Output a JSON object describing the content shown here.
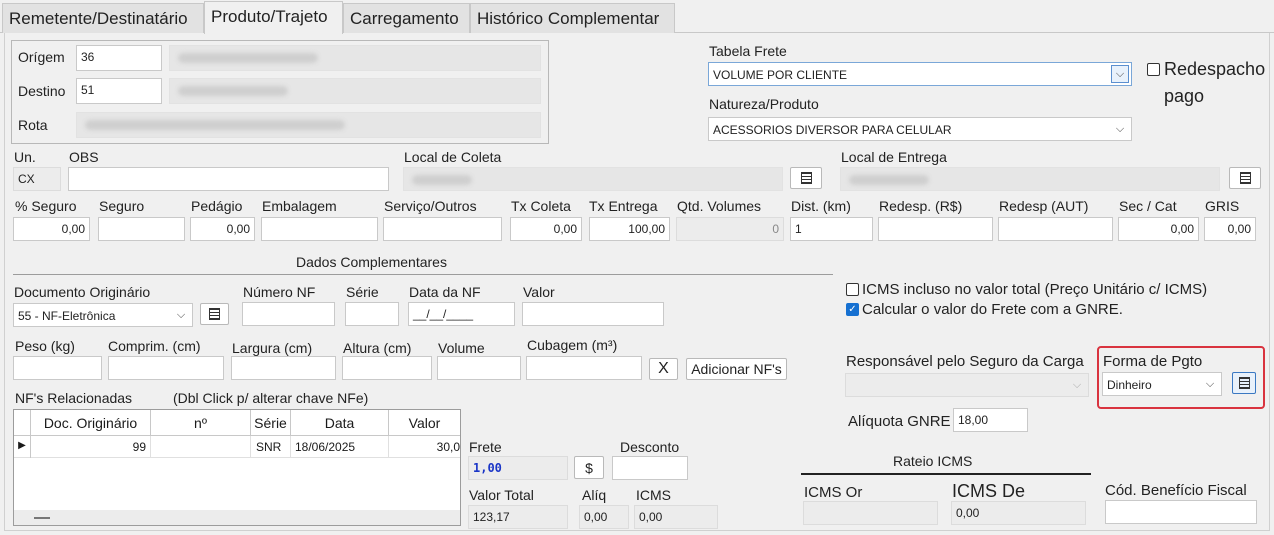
{
  "tabs": [
    "Remetente/Destinatário",
    "Produto/Trajeto",
    "Carregamento",
    "Histórico Complementar"
  ],
  "route": {
    "origem_label": "Orígem",
    "origem_value": "36",
    "destino_label": "Destino",
    "destino_value": "51",
    "rota_label": "Rota"
  },
  "tabela_frete": {
    "label": "Tabela Frete",
    "value": "VOLUME POR CLIENTE"
  },
  "natureza": {
    "label": "Natureza/Produto",
    "value": "ACESSORIOS DIVERSOR PARA CELULAR"
  },
  "redespacho": {
    "label_line1": "Redespacho",
    "label_line2": "pago"
  },
  "un": {
    "label": "Un.",
    "value": "CX"
  },
  "obs": {
    "label": "OBS",
    "value": ""
  },
  "local_coleta": {
    "label": "Local de Coleta"
  },
  "local_entrega": {
    "label": "Local de Entrega"
  },
  "values_row": {
    "pct_seguro": {
      "label": "% Seguro",
      "value": "0,00"
    },
    "seguro": {
      "label": "Seguro",
      "value": ""
    },
    "pedagio": {
      "label": "Pedágio",
      "value": "0,00"
    },
    "embalagem": {
      "label": "Embalagem",
      "value": ""
    },
    "servico": {
      "label": "Serviço/Outros",
      "value": ""
    },
    "tx_coleta": {
      "label": "Tx Coleta",
      "value": "0,00"
    },
    "tx_entrega": {
      "label": "Tx Entrega",
      "value": "100,00"
    },
    "qtd_volumes": {
      "label": "Qtd. Volumes",
      "value": "0"
    },
    "dist": {
      "label": "Dist. (km)",
      "value": "1"
    },
    "redesp_rs": {
      "label": "Redesp. (R$)",
      "value": ""
    },
    "redesp_aut": {
      "label": "Redesp (AUT)",
      "value": ""
    },
    "sec_cat": {
      "label": "Sec / Cat",
      "value": "0,00"
    },
    "gris": {
      "label": "GRIS",
      "value": "0,00"
    }
  },
  "dados_complementares": {
    "title": "Dados Complementares",
    "doc_originario": {
      "label": "Documento Originário",
      "value": "55 - NF-Eletrônica"
    },
    "numero_nf": {
      "label": "Número NF",
      "value": ""
    },
    "serie": {
      "label": "Série",
      "value": ""
    },
    "data_nf": {
      "label": "Data da NF",
      "value": "__/__/____"
    },
    "valor": {
      "label": "Valor",
      "value": ""
    },
    "peso": {
      "label": "Peso (kg)"
    },
    "comprim": {
      "label": "Comprim. (cm)"
    },
    "largura": {
      "label": "Largura (cm)"
    },
    "altura": {
      "label": "Altura (cm)"
    },
    "volume": {
      "label": "Volume"
    },
    "cubagem": {
      "label": "Cubagem (m³)"
    },
    "clear_label": "X",
    "adicionar_label": "Adicionar NF's"
  },
  "nfs": {
    "label": "NF's Relacionadas",
    "hint": "(Dbl Click p/ alterar chave NFe)",
    "columns": [
      "Doc. Originário",
      "nº",
      "Série",
      "Data",
      "Valor"
    ],
    "rows": [
      {
        "doc": "99",
        "n": "",
        "serie": "SNR",
        "data": "18/06/2025",
        "valor": "30,0"
      }
    ]
  },
  "frete": {
    "label": "Frete",
    "value": "1,00",
    "currency_btn": "$"
  },
  "desconto": {
    "label": "Desconto",
    "value": ""
  },
  "valor_total": {
    "label": "Valor Total",
    "value": "123,17"
  },
  "aliq": {
    "label": "Alíq",
    "value": "0,00"
  },
  "icms": {
    "label": "ICMS",
    "value": "0,00"
  },
  "checks": {
    "icms_incluso": {
      "label": "ICMS incluso no valor total (Preço Unitário c/ ICMS)",
      "checked": false
    },
    "calc_gnre": {
      "label": "Calcular o valor do Frete com a GNRE.",
      "checked": true
    }
  },
  "responsavel_seguro": {
    "label": "Responsável pelo Seguro da Carga",
    "value": ""
  },
  "forma_pgto": {
    "label": "Forma de Pgto",
    "value": "Dinheiro",
    "highlight": "#d9333f"
  },
  "aliquota_gnre": {
    "label": "Alíquota GNRE",
    "value": "18,00"
  },
  "rateio": {
    "title": "Rateio ICMS",
    "icms_or_label": "ICMS Or",
    "icms_de_label": "ICMS De",
    "icms_de_value": "0,00"
  },
  "cod_beneficio": {
    "label": "Cód. Benefício Fiscal",
    "value": ""
  }
}
